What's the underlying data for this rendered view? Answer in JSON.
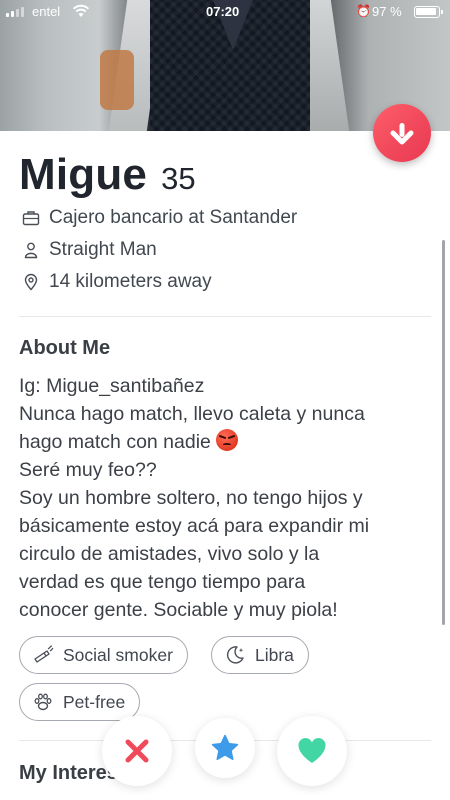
{
  "status_bar": {
    "carrier": "entel",
    "time": "07:20",
    "battery": "97 %"
  },
  "profile": {
    "name": "Migue",
    "age": "35",
    "job": "Cajero bancario at Santander",
    "orientation": "Straight Man",
    "distance": "14 kilometers away"
  },
  "about": {
    "title": "About Me",
    "lines": [
      "Ig: Migue_santibañez",
      "Nunca hago match, llevo caleta y nunca",
      "hago match con nadie",
      "Seré muy feo??",
      "Soy un hombre soltero, no tengo hijos y",
      "básicamente estoy acá para expandir mi",
      "circulo de amistades, vivo solo y la",
      "verdad es que tengo tiempo para",
      "conocer gente. Sociable y muy piola!"
    ]
  },
  "chips": {
    "smoker": "Social smoker",
    "zodiac": "Libra",
    "pets": "Pet-free"
  },
  "interests": {
    "title": "My Interests"
  },
  "colors": {
    "accent": "#f0465a",
    "nope": "#f0495a",
    "super": "#3d9be9",
    "like": "#42d6a4"
  },
  "icons": {
    "collapse": "arrow-down-icon",
    "nope": "close-icon",
    "super": "star-icon",
    "like": "heart-icon"
  }
}
